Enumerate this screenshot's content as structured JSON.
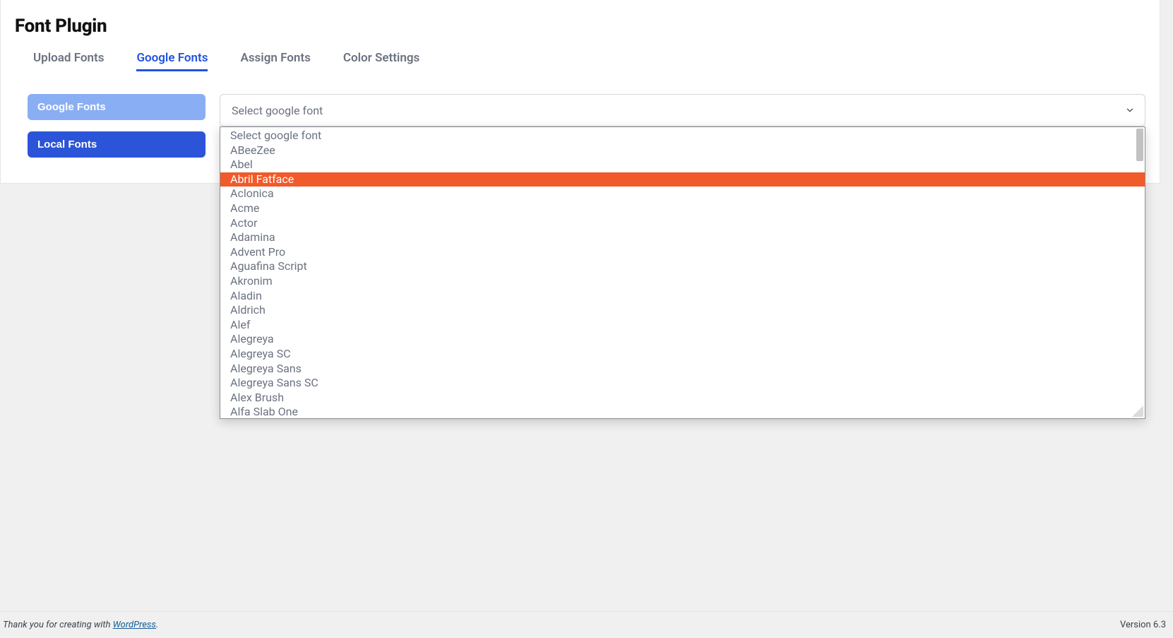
{
  "header": {
    "title": "Font Plugin"
  },
  "tabs": [
    {
      "label": "Upload Fonts",
      "active": false
    },
    {
      "label": "Google Fonts",
      "active": true
    },
    {
      "label": "Assign Fonts",
      "active": false
    },
    {
      "label": "Color Settings",
      "active": false
    }
  ],
  "sidebar": {
    "items": [
      {
        "label": "Google Fonts",
        "style": "light"
      },
      {
        "label": "Local Fonts",
        "style": "dark"
      }
    ]
  },
  "select": {
    "placeholder": "Select google font",
    "highlighted_index": 3,
    "options": [
      "Select google font",
      "ABeeZee",
      "Abel",
      "Abril Fatface",
      "Aclonica",
      "Acme",
      "Actor",
      "Adamina",
      "Advent Pro",
      "Aguafina Script",
      "Akronim",
      "Aladin",
      "Aldrich",
      "Alef",
      "Alegreya",
      "Alegreya SC",
      "Alegreya Sans",
      "Alegreya Sans SC",
      "Alex Brush",
      "Alfa Slab One"
    ]
  },
  "footer": {
    "thanks_prefix": "Thank you for creating with ",
    "thanks_link_text": "WordPress",
    "thanks_suffix": ".",
    "version": "Version 6.3"
  }
}
